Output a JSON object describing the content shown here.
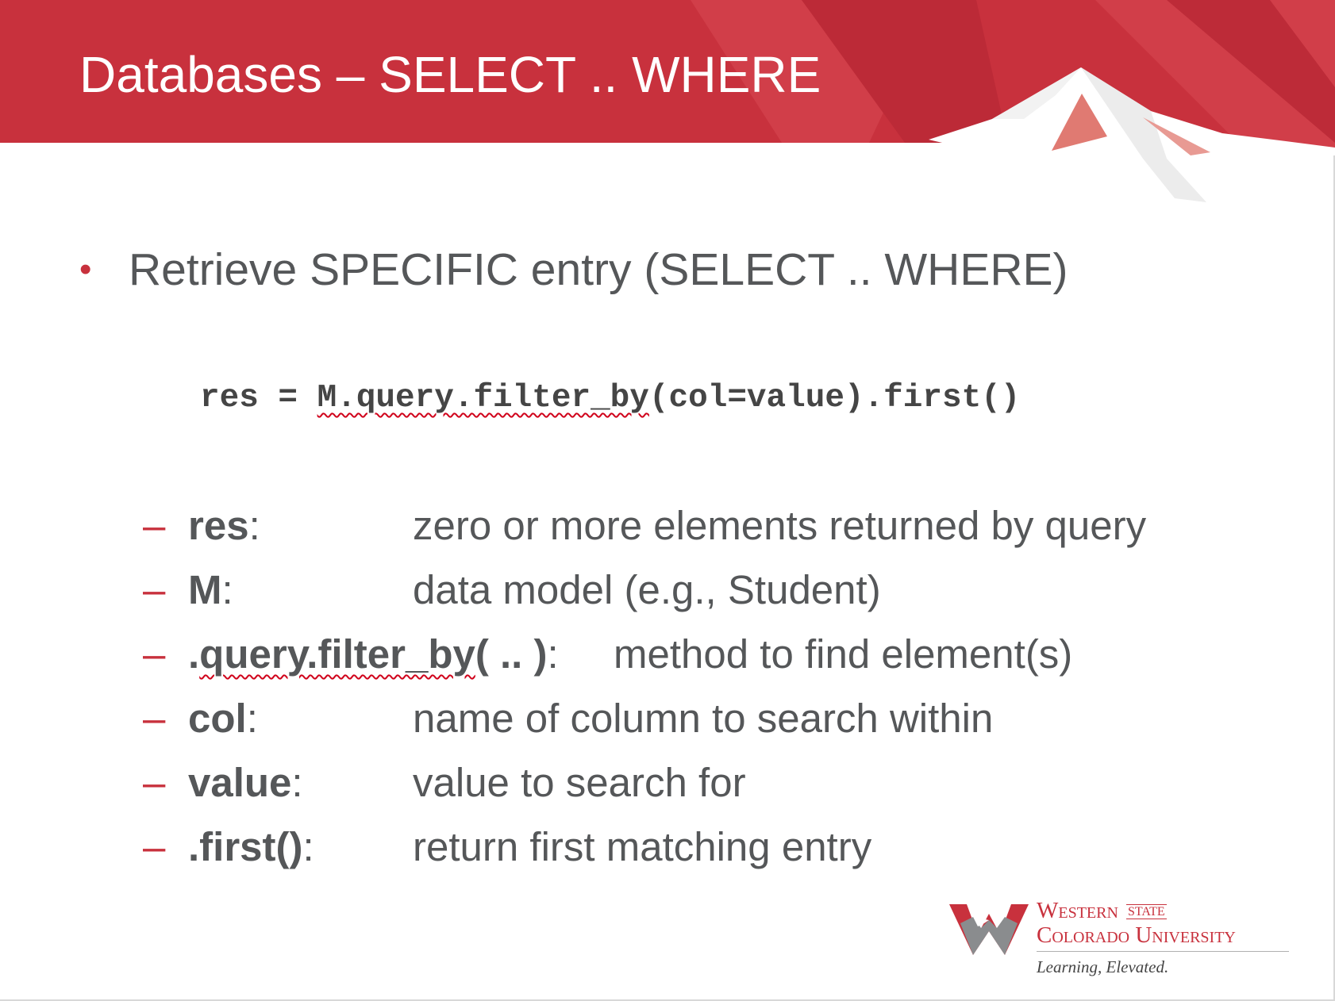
{
  "slide": {
    "title": "Databases – SELECT .. WHERE",
    "bullet": {
      "marker": "•",
      "text": "Retrieve SPECIFIC entry (SELECT .. WHERE)"
    },
    "code": {
      "prefix": "res = ",
      "flagged": "M.query.filter_by",
      "suffix": "(col=value).first()"
    },
    "definitions": [
      {
        "dash": "–",
        "term": "res",
        "colon": ":",
        "desc": "zero or more elements returned by query"
      },
      {
        "dash": "–",
        "term": "M",
        "colon": ":",
        "desc": "data model (e.g., Student)"
      },
      {
        "dash": "–",
        "term_dot": ".",
        "term": "query.filter_by",
        "term_rest": "( .. )",
        "colon": ":",
        "desc": "method to find element(s)"
      },
      {
        "dash": "–",
        "term": "col",
        "colon": ":",
        "desc": "name of column to search within"
      },
      {
        "dash": "–",
        "term": "value",
        "colon": ":",
        "desc": "value to search for"
      },
      {
        "dash": "–",
        "term": ".first()",
        "colon": ":",
        "desc": "return first matching entry"
      }
    ]
  },
  "logo": {
    "line1": "Western",
    "state": "STATE",
    "line2": "Colorado University",
    "tagline": "Learning, Elevated."
  },
  "colors": {
    "banner_red": "#c8313d",
    "text_gray": "#555759",
    "accent_red": "#c8313d",
    "spellcheck": "#d0021b"
  }
}
